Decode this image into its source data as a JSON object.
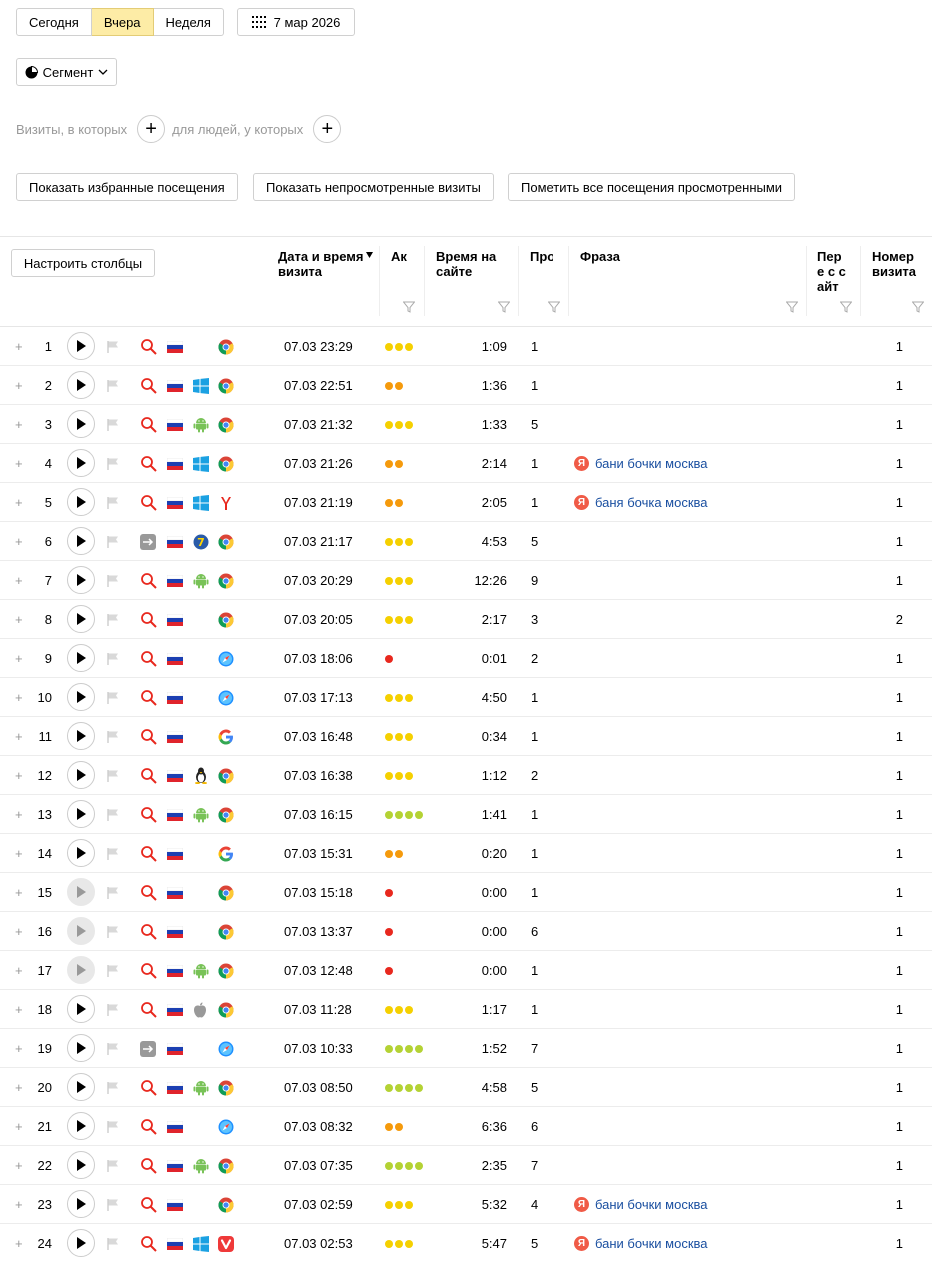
{
  "period_tabs": [
    "Сегодня",
    "Вчера",
    "Неделя"
  ],
  "active_period": 1,
  "date_label": "7 мар 2026",
  "segment_label": "Сегмент",
  "filters": {
    "visits_label": "Визиты, в которых",
    "people_label": "для людей, у которых"
  },
  "actions": {
    "favorites": "Показать избранные посещения",
    "unviewed": "Показать непросмотренные визиты",
    "mark_all": "Пометить все посещения просмотренными"
  },
  "configure_columns": "Настроить столбцы",
  "columns": {
    "datetime": "Дата и время визита",
    "activity": "Ак",
    "duration": "Время на сайте",
    "pages": "Про",
    "phrase": "Фраза",
    "first": "Пере с сайт",
    "visit_no": "Номер визита"
  },
  "colors": {
    "yellow": "#f5d000",
    "orange": "#f59a0c",
    "red": "#e8281e",
    "green": "#b4d234",
    "link": "#1a4fa0",
    "accent": "#fdeca6"
  },
  "rows": [
    {
      "n": "1",
      "play": "on",
      "src": "search",
      "os": "",
      "br": "chrome",
      "dt": "07.03 23:29",
      "act": [
        "yellow",
        "yellow",
        "yellow"
      ],
      "dur": "1:09",
      "pages": "1",
      "phrase": "",
      "visit": "1"
    },
    {
      "n": "2",
      "play": "on",
      "src": "search",
      "os": "windows",
      "br": "chrome",
      "dt": "07.03 22:51",
      "act": [
        "orange",
        "orange"
      ],
      "dur": "1:36",
      "pages": "1",
      "phrase": "",
      "visit": "1"
    },
    {
      "n": "3",
      "play": "on",
      "src": "search",
      "os": "android",
      "br": "chrome",
      "dt": "07.03 21:32",
      "act": [
        "yellow",
        "yellow",
        "yellow"
      ],
      "dur": "1:33",
      "pages": "5",
      "phrase": "",
      "visit": "1"
    },
    {
      "n": "4",
      "play": "on",
      "src": "search",
      "os": "windows",
      "br": "chrome",
      "dt": "07.03 21:26",
      "act": [
        "orange",
        "orange"
      ],
      "dur": "2:14",
      "pages": "1",
      "phrase": "бани бочки москва",
      "visit": "1"
    },
    {
      "n": "5",
      "play": "on",
      "src": "search",
      "os": "windows",
      "br": "yandex",
      "dt": "07.03 21:19",
      "act": [
        "orange",
        "orange"
      ],
      "dur": "2:05",
      "pages": "1",
      "phrase": "баня бочка москва",
      "visit": "1"
    },
    {
      "n": "6",
      "play": "on",
      "src": "direct",
      "os": "win7",
      "br": "chrome",
      "dt": "07.03 21:17",
      "act": [
        "yellow",
        "yellow",
        "yellow"
      ],
      "dur": "4:53",
      "pages": "5",
      "phrase": "",
      "visit": "1"
    },
    {
      "n": "7",
      "play": "on",
      "src": "search",
      "os": "android",
      "br": "chrome",
      "dt": "07.03 20:29",
      "act": [
        "yellow",
        "yellow",
        "yellow"
      ],
      "dur": "12:26",
      "pages": "9",
      "phrase": "",
      "visit": "1"
    },
    {
      "n": "8",
      "play": "on",
      "src": "search",
      "os": "",
      "br": "chrome",
      "dt": "07.03 20:05",
      "act": [
        "yellow",
        "yellow",
        "yellow"
      ],
      "dur": "2:17",
      "pages": "3",
      "phrase": "",
      "visit": "2"
    },
    {
      "n": "9",
      "play": "on",
      "src": "search",
      "os": "",
      "br": "safari",
      "dt": "07.03 18:06",
      "act": [
        "red"
      ],
      "dur": "0:01",
      "pages": "2",
      "phrase": "",
      "visit": "1"
    },
    {
      "n": "10",
      "play": "on",
      "src": "search",
      "os": "",
      "br": "safari",
      "dt": "07.03 17:13",
      "act": [
        "yellow",
        "yellow",
        "yellow"
      ],
      "dur": "4:50",
      "pages": "1",
      "phrase": "",
      "visit": "1"
    },
    {
      "n": "11",
      "play": "on",
      "src": "search",
      "os": "",
      "br": "google",
      "dt": "07.03 16:48",
      "act": [
        "yellow",
        "yellow",
        "yellow"
      ],
      "dur": "0:34",
      "pages": "1",
      "phrase": "",
      "visit": "1"
    },
    {
      "n": "12",
      "play": "on",
      "src": "search",
      "os": "linux",
      "br": "chrome",
      "dt": "07.03 16:38",
      "act": [
        "yellow",
        "yellow",
        "yellow"
      ],
      "dur": "1:12",
      "pages": "2",
      "phrase": "",
      "visit": "1"
    },
    {
      "n": "13",
      "play": "on",
      "src": "search",
      "os": "android",
      "br": "chrome",
      "dt": "07.03 16:15",
      "act": [
        "green",
        "green",
        "green",
        "green"
      ],
      "dur": "1:41",
      "pages": "1",
      "phrase": "",
      "visit": "1"
    },
    {
      "n": "14",
      "play": "on",
      "src": "search",
      "os": "",
      "br": "google",
      "dt": "07.03 15:31",
      "act": [
        "orange",
        "orange"
      ],
      "dur": "0:20",
      "pages": "1",
      "phrase": "",
      "visit": "1"
    },
    {
      "n": "15",
      "play": "grey",
      "src": "search",
      "os": "",
      "br": "chrome",
      "dt": "07.03 15:18",
      "act": [
        "red"
      ],
      "dur": "0:00",
      "pages": "1",
      "phrase": "",
      "visit": "1"
    },
    {
      "n": "16",
      "play": "grey",
      "src": "search",
      "os": "",
      "br": "chrome",
      "dt": "07.03 13:37",
      "act": [
        "red"
      ],
      "dur": "0:00",
      "pages": "6",
      "phrase": "",
      "visit": "1"
    },
    {
      "n": "17",
      "play": "grey",
      "src": "search",
      "os": "android",
      "br": "chrome",
      "dt": "07.03 12:48",
      "act": [
        "red"
      ],
      "dur": "0:00",
      "pages": "1",
      "phrase": "",
      "visit": "1"
    },
    {
      "n": "18",
      "play": "on",
      "src": "search",
      "os": "apple",
      "br": "chrome",
      "dt": "07.03 11:28",
      "act": [
        "yellow",
        "yellow",
        "yellow"
      ],
      "dur": "1:17",
      "pages": "1",
      "phrase": "",
      "visit": "1"
    },
    {
      "n": "19",
      "play": "on",
      "src": "direct",
      "os": "",
      "br": "safari",
      "dt": "07.03 10:33",
      "act": [
        "green",
        "green",
        "green",
        "green"
      ],
      "dur": "1:52",
      "pages": "7",
      "phrase": "",
      "visit": "1"
    },
    {
      "n": "20",
      "play": "on",
      "src": "search",
      "os": "android",
      "br": "chrome",
      "dt": "07.03 08:50",
      "act": [
        "green",
        "green",
        "green",
        "green"
      ],
      "dur": "4:58",
      "pages": "5",
      "phrase": "",
      "visit": "1"
    },
    {
      "n": "21",
      "play": "on",
      "src": "search",
      "os": "",
      "br": "safari",
      "dt": "07.03 08:32",
      "act": [
        "orange",
        "orange"
      ],
      "dur": "6:36",
      "pages": "6",
      "phrase": "",
      "visit": "1"
    },
    {
      "n": "22",
      "play": "on",
      "src": "search",
      "os": "android",
      "br": "chrome",
      "dt": "07.03 07:35",
      "act": [
        "green",
        "green",
        "green",
        "green"
      ],
      "dur": "2:35",
      "pages": "7",
      "phrase": "",
      "visit": "1"
    },
    {
      "n": "23",
      "play": "on",
      "src": "search",
      "os": "",
      "br": "chrome",
      "dt": "07.03 02:59",
      "act": [
        "yellow",
        "yellow",
        "yellow"
      ],
      "dur": "5:32",
      "pages": "4",
      "phrase": "бани бочки москва",
      "visit": "1"
    },
    {
      "n": "24",
      "play": "on",
      "src": "search",
      "os": "windows",
      "br": "vivaldi",
      "dt": "07.03 02:53",
      "act": [
        "yellow",
        "yellow",
        "yellow"
      ],
      "dur": "5:47",
      "pages": "5",
      "phrase": "бани бочки москва",
      "visit": "1"
    }
  ]
}
